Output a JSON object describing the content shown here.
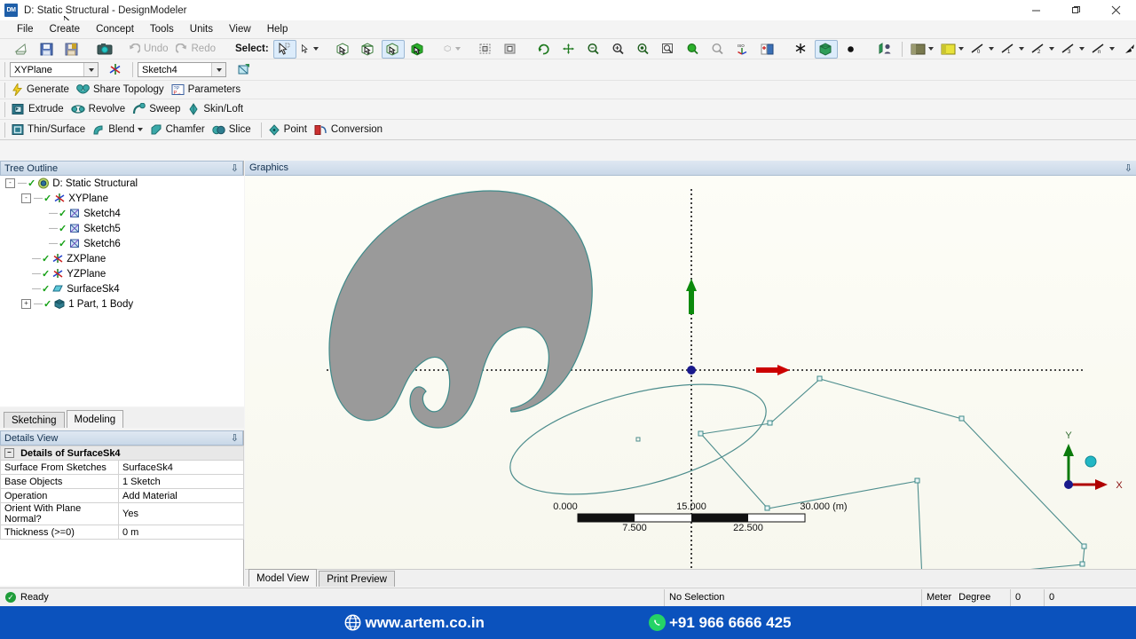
{
  "window": {
    "title": "D: Static Structural - DesignModeler",
    "app_badge": "DM",
    "minimize": "—",
    "maximize": "❐",
    "close": "✕"
  },
  "menu": [
    "File",
    "Create",
    "Concept",
    "Tools",
    "Units",
    "View",
    "Help"
  ],
  "toolbar_main": {
    "icons": [
      "new-icon",
      "save-icon",
      "save-as-icon",
      "screenshot-icon"
    ],
    "undo_label": "Undo",
    "redo_label": "Redo",
    "select_label": "Select:",
    "select_icons": [
      "select-single-icon",
      "select-box-icon",
      "filter-edge-icon",
      "filter-face-icon",
      "filter-body-icon",
      "filter-solid-icon",
      "extend-selection-icon",
      "select-all-icon",
      "invert-selection-icon"
    ],
    "view_icons": [
      "rotate-icon",
      "pan-icon",
      "zoom-icon",
      "box-zoom-icon",
      "zoom-in-icon",
      "zoom-out-icon",
      "zoom-to-fit-icon",
      "magnifier-icon",
      "previous-view-icon",
      "next-view-icon",
      "iso-view-icon",
      "look-at-icon",
      "plane-icon",
      "body-display-icon",
      "point-display-icon",
      "ruler-icon"
    ],
    "right_icons": [
      "edge-color-icon",
      "edge-thickness-icon",
      "edge-joint-0-icon",
      "edge-joint-1-icon",
      "edge-joint-2-icon",
      "edge-joint-3-icon",
      "edge-joint-n-icon",
      "arrow-icon",
      "flag-icon"
    ]
  },
  "plane_bar": {
    "plane_value": "XYPlane",
    "new_plane_icon": "new-plane-icon",
    "sketch_value": "Sketch4",
    "new_sketch_icon": "new-sketch-icon"
  },
  "toolbar_commands": [
    {
      "label": "Generate",
      "icon": "generate-icon"
    },
    {
      "label": "Share Topology",
      "icon": "share-topology-icon"
    },
    {
      "label": "Parameters",
      "icon": "parameters-icon"
    }
  ],
  "toolbar_features": [
    {
      "label": "Extrude",
      "icon": "extrude-icon"
    },
    {
      "label": "Revolve",
      "icon": "revolve-icon"
    },
    {
      "label": "Sweep",
      "icon": "sweep-icon"
    },
    {
      "label": "Skin/Loft",
      "icon": "skin-loft-icon"
    }
  ],
  "toolbar_modify": [
    {
      "label": "Thin/Surface",
      "icon": "thin-surface-icon"
    },
    {
      "label": "Blend",
      "icon": "blend-icon"
    },
    {
      "label": "Chamfer",
      "icon": "chamfer-icon"
    },
    {
      "label": "Slice",
      "icon": "slice-icon"
    },
    {
      "label": "Point",
      "icon": "point-icon"
    },
    {
      "label": "Conversion",
      "icon": "conversion-icon"
    }
  ],
  "tree": {
    "title": "Tree Outline",
    "nodes": [
      {
        "label": "D: Static Structural",
        "depth": 0,
        "expander": "-",
        "icon": "model-icon"
      },
      {
        "label": "XYPlane",
        "depth": 1,
        "expander": "-",
        "icon": "plane-icon"
      },
      {
        "label": "Sketch4",
        "depth": 2,
        "expander": "",
        "icon": "sketch-icon"
      },
      {
        "label": "Sketch5",
        "depth": 2,
        "expander": "",
        "icon": "sketch-icon"
      },
      {
        "label": "Sketch6",
        "depth": 2,
        "expander": "",
        "icon": "sketch-icon"
      },
      {
        "label": "ZXPlane",
        "depth": 1,
        "expander": "",
        "icon": "plane-icon"
      },
      {
        "label": "YZPlane",
        "depth": 1,
        "expander": "",
        "icon": "plane-icon"
      },
      {
        "label": "SurfaceSk4",
        "depth": 1,
        "expander": "",
        "icon": "surface-icon"
      },
      {
        "label": "1 Part, 1 Body",
        "depth": 1,
        "expander": "+",
        "icon": "body-icon"
      }
    ]
  },
  "mode_tabs": [
    {
      "label": "Sketching",
      "active": false
    },
    {
      "label": "Modeling",
      "active": true
    }
  ],
  "details": {
    "title": "Details View",
    "header": "Details of SurfaceSk4",
    "rows": [
      {
        "key": "Surface From Sketches",
        "value": "SurfaceSk4"
      },
      {
        "key": "Base Objects",
        "value": "1 Sketch"
      },
      {
        "key": "Operation",
        "value": "Add Material"
      },
      {
        "key": "Orient With Plane Normal?",
        "value": "Yes"
      },
      {
        "key": "Thickness (>=0)",
        "value": "0 m"
      }
    ]
  },
  "graphics": {
    "title": "Graphics",
    "scale_bar": {
      "top_labels": [
        "0.000",
        "15.000",
        "30.000 (m)"
      ],
      "bottom_labels": [
        "7.500",
        "22.500"
      ]
    },
    "triad": {
      "x_label": "X",
      "y_label": "Y"
    }
  },
  "view_tabs": [
    {
      "label": "Model View",
      "active": true
    },
    {
      "label": "Print Preview",
      "active": false
    }
  ],
  "status": {
    "ready": "Ready",
    "selection": "No Selection",
    "units_length": "Meter",
    "units_angle": "Degree",
    "field1": "0",
    "field2": "0"
  },
  "banner": {
    "website": "www.artem.co.in",
    "phone": "+91 966 6666 425"
  },
  "colors": {
    "banner_bg": "#0b52bd",
    "sketch_line": "#4d8d8d",
    "surface_fill": "#9a9a9a",
    "axis_x": "#cc0000",
    "axis_y": "#0b8a0b",
    "origin": "#1a1a8c"
  }
}
